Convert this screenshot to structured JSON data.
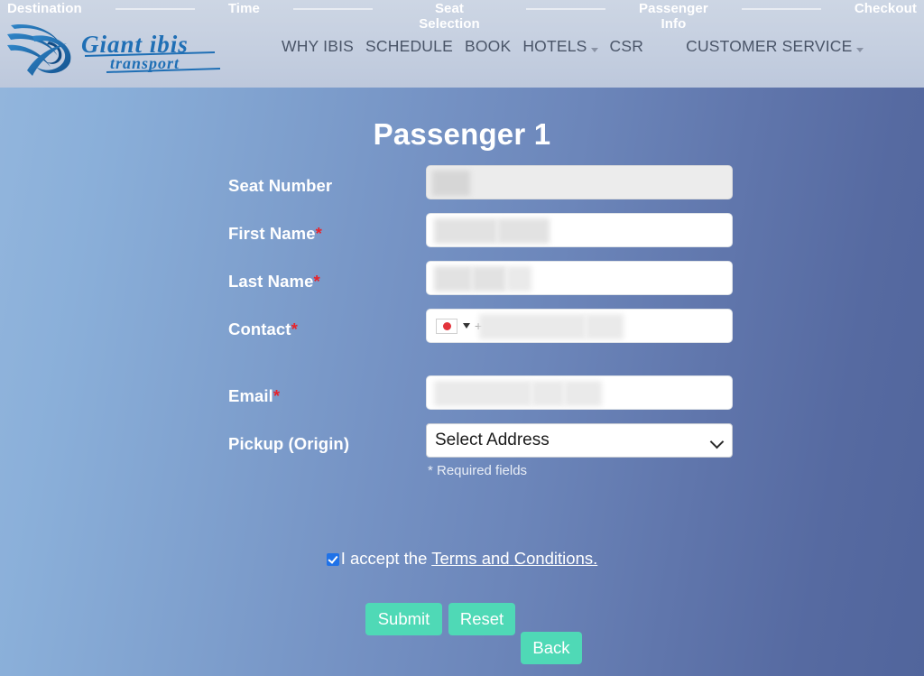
{
  "header": {
    "progress_steps": [
      {
        "label": "Destination"
      },
      {
        "label": "Time"
      },
      {
        "label": "Seat Selection"
      },
      {
        "label": "Passenger\nInfo"
      },
      {
        "label": "Checkout"
      }
    ],
    "logo_text_line1": "Giant ibis",
    "logo_text_line2": "transport",
    "nav": [
      {
        "label": "WHY IBIS",
        "has_caret": false
      },
      {
        "label": "SCHEDULE",
        "has_caret": false
      },
      {
        "label": "BOOK",
        "has_caret": false
      },
      {
        "label": "HOTELS",
        "has_caret": true
      },
      {
        "label": "CSR",
        "has_caret": false
      },
      {
        "label": "CUSTOMER SERVICE",
        "has_caret": true
      }
    ]
  },
  "main": {
    "title": "Passenger 1",
    "fields": [
      {
        "label": "Seat Number",
        "required": false,
        "value": "",
        "type": "text-readonly"
      },
      {
        "label": "First Name",
        "required": true,
        "value": "",
        "type": "text"
      },
      {
        "label": "Last Name",
        "required": true,
        "value": "",
        "type": "text"
      },
      {
        "label": "Contact",
        "required": true,
        "value": "",
        "type": "phone"
      },
      {
        "label": "Email",
        "required": true,
        "value": "",
        "type": "email"
      },
      {
        "label": "Pickup (Origin)",
        "required": false,
        "value": "Select Address",
        "type": "select"
      }
    ],
    "labels": {
      "seat_number": "Seat Number",
      "first_name": "First Name",
      "last_name": "Last Name",
      "contact": "Contact",
      "email": "Email",
      "pickup": "Pickup (Origin)"
    },
    "required_marker": "*",
    "required_note": "* Required fields",
    "pickup_selected": "Select Address",
    "phone_country_flag": "japan-flag",
    "phone_prefix": "+",
    "terms": {
      "checked": true,
      "text_before": "I accept the ",
      "link_text": "Terms and Conditions.",
      "link_line1": "Terms and",
      "link_line2": "Conditions."
    },
    "buttons": {
      "submit": "Submit",
      "reset": "Reset",
      "back": "Back"
    }
  },
  "colors": {
    "background_left": "#93b6dd",
    "background_right": "#51659c",
    "header_band": "#c5cfe0",
    "button_teal": "#4fd9b6",
    "required_red": "#e8232a",
    "checkbox_blue": "#1f72e8",
    "logo_blue": "#1f6fb5"
  }
}
